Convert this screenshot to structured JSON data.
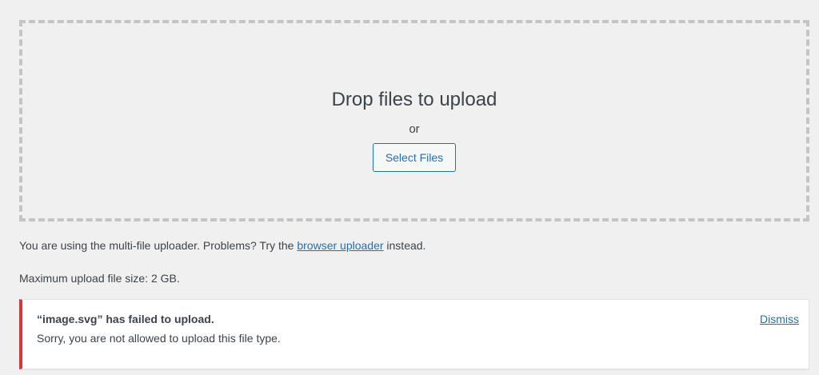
{
  "uploader": {
    "drop_title": "Drop files to upload",
    "or_text": "or",
    "select_button_label": "Select Files"
  },
  "info": {
    "multi_prefix": "You are using the multi-file uploader. Problems? Try the ",
    "multi_link": "browser uploader",
    "multi_suffix": " instead.",
    "max_size": "Maximum upload file size: 2 GB."
  },
  "error": {
    "title": "“image.svg” has failed to upload.",
    "message": "Sorry, you are not allowed to upload this file type.",
    "dismiss_label": "Dismiss"
  },
  "colors": {
    "accent": "#2271b1",
    "error": "#d63638",
    "background": "#f0f0f1"
  }
}
